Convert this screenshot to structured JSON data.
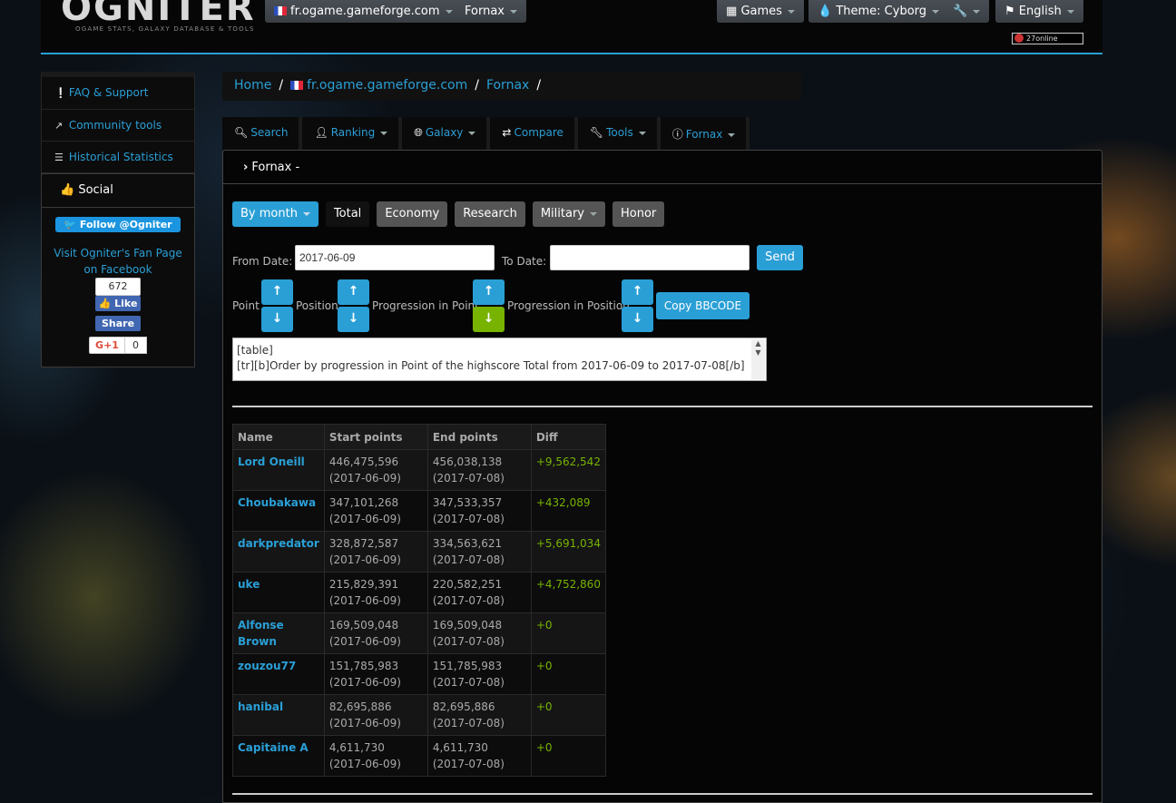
{
  "brand": {
    "logo": "OGNITER",
    "tagline": "OGAME STATS, GALAXY DATABASE & TOOLS"
  },
  "topnav": {
    "server": "fr.ogame.gameforge.com",
    "universe": "Fornax",
    "games": "Games",
    "theme": "Theme: Cyborg",
    "language": "English",
    "online_count": "27",
    "online_label": "online"
  },
  "sidebar": {
    "items": [
      {
        "label": "FAQ & Support",
        "icon": "exclamation-circle-icon"
      },
      {
        "label": "Community tools",
        "icon": "external-link-icon"
      },
      {
        "label": "Historical Statistics",
        "icon": "list-icon"
      }
    ],
    "social": {
      "title": "Social",
      "twitter": "Follow @Ogniter",
      "facebook_text": "Visit Ogniter's Fan Page on Facebook",
      "like_count": "672",
      "like": "Like",
      "share": "Share",
      "gplus": "G+1",
      "gplus_count": "0"
    }
  },
  "breadcrumb": {
    "home": "Home",
    "server": "fr.ogame.gameforge.com",
    "universe": "Fornax"
  },
  "tabs": [
    {
      "label": "Search",
      "icon": "search-icon",
      "caret": false
    },
    {
      "label": "Ranking",
      "icon": "user-icon",
      "caret": true
    },
    {
      "label": "Galaxy",
      "icon": "globe-icon",
      "caret": true
    },
    {
      "label": "Compare",
      "icon": "shuffle-icon",
      "caret": false
    },
    {
      "label": "Tools",
      "icon": "wrench-icon",
      "caret": true
    },
    {
      "label": "Fornax",
      "icon": "info-icon",
      "caret": true
    }
  ],
  "panel": {
    "title": "Fornax -",
    "filters": [
      "By month",
      "Total",
      "Economy",
      "Research",
      "Military",
      "Honor"
    ],
    "form": {
      "from_label": "From Date:",
      "from_value": "2017-06-09",
      "to_label": "To Date:",
      "to_value": "",
      "send": "Send"
    },
    "sort": {
      "point": "Point",
      "position": "Position",
      "prog_point": "Progression in Point",
      "prog_position": "Progression in Position",
      "copy": "Copy BBCODE"
    },
    "bbcode_lines": [
      "[table]",
      "[tr][b]Order by progression in Point of the highscore Total from 2017-06-09 to 2017-07-08[/b]"
    ]
  },
  "table": {
    "headers": [
      "Name",
      "Start points",
      "End points",
      "Diff"
    ],
    "rows": [
      {
        "name": "Lord Oneill",
        "start": "446,475,596 (2017-06-09)",
        "end": "456,038,138 (2017-07-08)",
        "diff": "+9,562,542"
      },
      {
        "name": "Choubakawa",
        "start": "347,101,268 (2017-06-09)",
        "end": "347,533,357 (2017-07-08)",
        "diff": "+432,089"
      },
      {
        "name": "darkpredator",
        "start": "328,872,587 (2017-06-09)",
        "end": "334,563,621 (2017-07-08)",
        "diff": "+5,691,034"
      },
      {
        "name": "uke",
        "start": "215,829,391 (2017-06-09)",
        "end": "220,582,251 (2017-07-08)",
        "diff": "+4,752,860"
      },
      {
        "name": "Alfonse Brown",
        "start": "169,509,048 (2017-06-09)",
        "end": "169,509,048 (2017-07-08)",
        "diff": "+0"
      },
      {
        "name": "zouzou77",
        "start": "151,785,983 (2017-06-09)",
        "end": "151,785,983 (2017-07-08)",
        "diff": "+0"
      },
      {
        "name": "hanibal",
        "start": "82,695,886 (2017-06-09)",
        "end": "82,695,886 (2017-07-08)",
        "diff": "+0"
      },
      {
        "name": "Capitaine A",
        "start": "4,611,730 (2017-06-09)",
        "end": "4,611,730 (2017-07-08)",
        "diff": "+0"
      }
    ]
  },
  "colors": {
    "accent": "#2a9fd6",
    "success": "#77b300",
    "panel_bg": "#050505"
  }
}
